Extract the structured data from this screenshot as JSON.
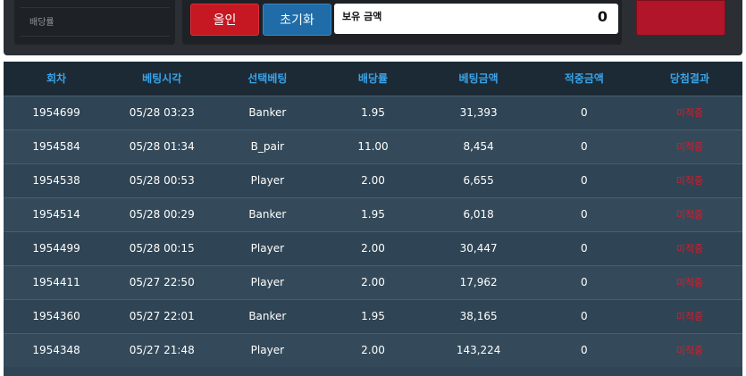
{
  "top_panel": {
    "left_label": "배당률",
    "allin_label": "올인",
    "reset_label": "초기화",
    "balance_label": "보유 금액",
    "balance_value": "0"
  },
  "table": {
    "headers": [
      "회차",
      "베팅시각",
      "선택베팅",
      "배당률",
      "베팅금액",
      "적중금액",
      "당첨결과"
    ],
    "rows": [
      {
        "round": "1954699",
        "time": "05/28 03:23",
        "pick": "Banker",
        "odds": "1.95",
        "amount": "31,393",
        "win": "0",
        "result": "미적중"
      },
      {
        "round": "1954584",
        "time": "05/28 01:34",
        "pick": "B_pair",
        "odds": "11.00",
        "amount": "8,454",
        "win": "0",
        "result": "미적중"
      },
      {
        "round": "1954538",
        "time": "05/28 00:53",
        "pick": "Player",
        "odds": "2.00",
        "amount": "6,655",
        "win": "0",
        "result": "미적중"
      },
      {
        "round": "1954514",
        "time": "05/28 00:29",
        "pick": "Banker",
        "odds": "1.95",
        "amount": "6,018",
        "win": "0",
        "result": "미적중"
      },
      {
        "round": "1954499",
        "time": "05/28 00:15",
        "pick": "Player",
        "odds": "2.00",
        "amount": "30,447",
        "win": "0",
        "result": "미적중"
      },
      {
        "round": "1954411",
        "time": "05/27 22:50",
        "pick": "Player",
        "odds": "2.00",
        "amount": "17,962",
        "win": "0",
        "result": "미적중"
      },
      {
        "round": "1954360",
        "time": "05/27 22:01",
        "pick": "Banker",
        "odds": "1.95",
        "amount": "38,165",
        "win": "0",
        "result": "미적중"
      },
      {
        "round": "1954348",
        "time": "05/27 21:48",
        "pick": "Player",
        "odds": "2.00",
        "amount": "143,224",
        "win": "0",
        "result": "미적중"
      }
    ]
  },
  "colors": {
    "header_text": "#3aa3e8",
    "result_text": "#d01f2f",
    "allin_button": "#c51822",
    "reset_button": "#1f6ca8",
    "bet_button": "#b0152a"
  }
}
